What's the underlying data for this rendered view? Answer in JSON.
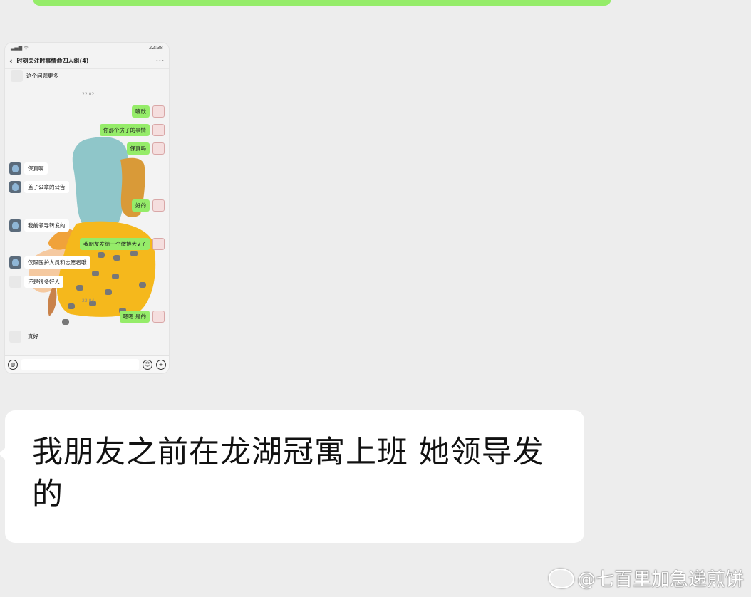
{
  "screenshot": {
    "status_time": "22:38",
    "title": "时刻关注时事情命四人组(4)",
    "messages": [
      {
        "side": "left",
        "avatar": "blank",
        "text": "这个问题更多"
      },
      {
        "side": "right",
        "avatar": "self",
        "text": "嘛欣"
      },
      {
        "side": "right",
        "avatar": "self",
        "text": "你那个房子的事情"
      },
      {
        "side": "right",
        "avatar": "self",
        "text": "保真吗"
      },
      {
        "side": "left",
        "avatar": "person",
        "text": "保真啊"
      },
      {
        "side": "left",
        "avatar": "person",
        "text": "盖了公章的公告"
      },
      {
        "side": "right",
        "avatar": "self",
        "text": "好的"
      },
      {
        "side": "left",
        "avatar": "person",
        "text": "我前领导转发的"
      },
      {
        "side": "right",
        "avatar": "self",
        "text": "我朋友发给一个微博大∨了"
      },
      {
        "side": "left",
        "avatar": "person",
        "text": "仅限医护人员和志愿者哦"
      },
      {
        "side": "left",
        "avatar": "blank",
        "text": "还是很多好人"
      },
      {
        "side": "right",
        "avatar": "self",
        "text": "嗯嗯 是的"
      },
      {
        "side": "left",
        "avatar": "blank",
        "text": "真好"
      }
    ],
    "timestamps": [
      "22:02",
      "22:04"
    ]
  },
  "bubble": {
    "text": "我朋友之前在龙湖冠寓上班 她领导发的"
  },
  "watermark": {
    "text": "@七百里加急递煎饼"
  },
  "colors": {
    "background": "#ededed",
    "green_bubble": "#95ec69",
    "white_bubble": "#ffffff"
  }
}
